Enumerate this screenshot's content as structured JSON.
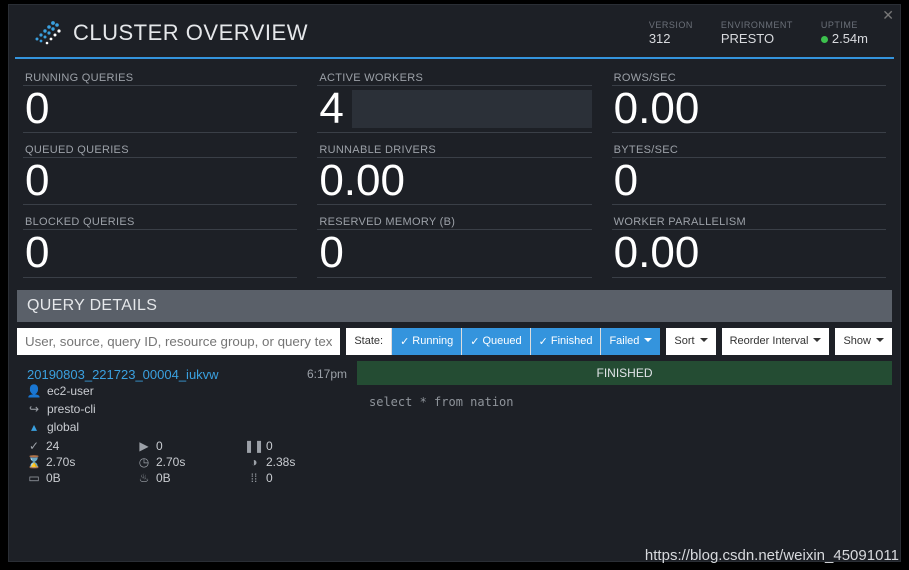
{
  "header": {
    "title": "CLUSTER OVERVIEW",
    "meta": {
      "version_label": "VERSION",
      "version_value": "312",
      "env_label": "ENVIRONMENT",
      "env_value": "PRESTO",
      "uptime_label": "UPTIME",
      "uptime_value": "2.54m"
    }
  },
  "metrics": [
    {
      "label": "RUNNING QUERIES",
      "value": "0",
      "spark": false
    },
    {
      "label": "ACTIVE WORKERS",
      "value": "4",
      "spark": true
    },
    {
      "label": "ROWS/SEC",
      "value": "0.00",
      "spark": false
    },
    {
      "label": "QUEUED QUERIES",
      "value": "0",
      "spark": false
    },
    {
      "label": "RUNNABLE DRIVERS",
      "value": "0.00",
      "spark": false
    },
    {
      "label": "BYTES/SEC",
      "value": "0",
      "spark": false
    },
    {
      "label": "BLOCKED QUERIES",
      "value": "0",
      "spark": false
    },
    {
      "label": "RESERVED MEMORY (B)",
      "value": "0",
      "spark": false
    },
    {
      "label": "WORKER PARALLELISM",
      "value": "0.00",
      "spark": false
    }
  ],
  "query_details": {
    "header": "QUERY DETAILS",
    "search_placeholder": "User, source, query ID, resource group, or query text",
    "state_label": "State:",
    "filters": {
      "running": "Running",
      "queued": "Queued",
      "finished": "Finished",
      "failed": "Failed"
    },
    "sort_label": "Sort",
    "reorder_label": "Reorder Interval",
    "show_label": "Show"
  },
  "query": {
    "id": "20190803_221723_00004_iukvw",
    "time": "6:17pm",
    "user": "ec2-user",
    "source": "presto-cli",
    "resource_group": "global",
    "stats": {
      "completed": "24",
      "running": "0",
      "queued": "0",
      "elapsed": "2.70s",
      "cpu": "2.70s",
      "scheduled": "2.38s",
      "memory": "0B",
      "peak": "0B",
      "splits": "0"
    },
    "status": "FINISHED",
    "sql": "select * from nation"
  },
  "watermark": "https://blog.csdn.net/weixin_45091011"
}
